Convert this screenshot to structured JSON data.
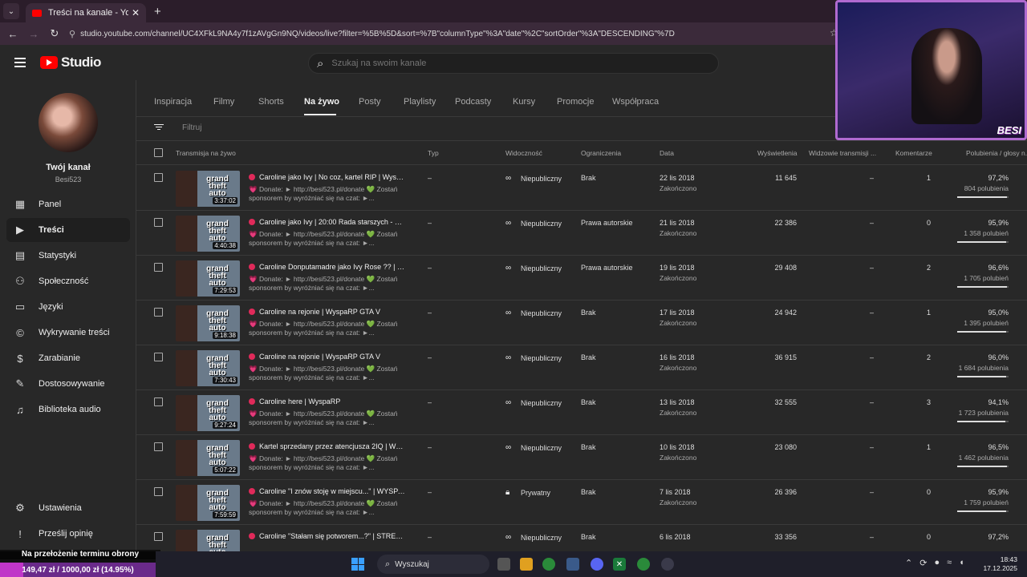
{
  "browser": {
    "tab_title": "Treści na kanale - YouTube Studio",
    "url": "studio.youtube.com/channel/UC4XFkL9NA4y7f1zAVgGn9NQ/videos/live?filter=%5B%5D&sort=%7B\"columnType\"%3A\"date\"%2C\"sortOrder\"%3A\"DESCENDING\"%7D"
  },
  "header": {
    "logo_text": "Studio",
    "search_placeholder": "Szukaj na swoim kanale"
  },
  "sidebar": {
    "channel_title": "Twój kanał",
    "channel_handle": "Besi523",
    "items": [
      {
        "label": "Panel",
        "icon": "dashboard-icon"
      },
      {
        "label": "Treści",
        "icon": "content-icon"
      },
      {
        "label": "Statystyki",
        "icon": "analytics-icon"
      },
      {
        "label": "Społeczność",
        "icon": "community-icon"
      },
      {
        "label": "Języki",
        "icon": "subtitles-icon"
      },
      {
        "label": "Wykrywanie treści",
        "icon": "copyright-icon"
      },
      {
        "label": "Zarabianie",
        "icon": "monetization-icon"
      },
      {
        "label": "Dostosowywanie",
        "icon": "customization-icon"
      },
      {
        "label": "Biblioteka audio",
        "icon": "audio-library-icon"
      }
    ],
    "settings_label": "Ustawienia",
    "feedback_label": "Prześlij opinię"
  },
  "content_tabs": [
    "Inspiracja",
    "Filmy",
    "Shorts",
    "Na żywo",
    "Posty",
    "Playlisty",
    "Podcasty",
    "Kursy",
    "Promocje",
    "Współpraca"
  ],
  "active_tab": "Na żywo",
  "filter_placeholder": "Filtruj",
  "columns": {
    "title": "Transmisja na żywo",
    "type": "Typ",
    "visibility": "Widoczność",
    "restrictions": "Ograniczenia",
    "date": "Data",
    "views": "Wyświetlenia",
    "live_viewers": "Widzowie transmisji ...",
    "comments": "Komentarze",
    "likes": "Polubienia / głosy n..."
  },
  "rows": [
    {
      "duration": "3:37:02",
      "title": "Caroline jako Ivy | No coz, kartel RIP | WyspaR...",
      "desc": "💗 Donate: ► http://besi523.pl/donate 💚 Zostań sponsorem by wyróżniać się na czat: ►...",
      "type": "–",
      "visibility": "Niepubliczny",
      "visibility_icon": "link-icon",
      "restrictions": "Brak",
      "date": "22 lis 2018",
      "status": "Zakończono",
      "views": "11 645",
      "live": "–",
      "comments": "1",
      "pct": "97,2%",
      "likes": "804 polubienia",
      "ratio": 0.972
    },
    {
      "duration": "4:40:38",
      "title": "Caroline jako Ivy | 20:00 Rada starszych - koni...",
      "desc": "💗 Donate: ► http://besi523.pl/donate 💚 Zostań sponsorem by wyróżniać się na czat: ►...",
      "type": "–",
      "visibility": "Niepubliczny",
      "visibility_icon": "link-icon",
      "restrictions": "Prawa autorskie",
      "date": "21 lis 2018",
      "status": "Zakończono",
      "views": "22 386",
      "live": "–",
      "comments": "0",
      "pct": "95,9%",
      "likes": "1 358 polubień",
      "ratio": 0.959
    },
    {
      "duration": "7:29:53",
      "title": "Caroline Donputamadre jako Ivy Rose ?? | Wy...",
      "desc": "💗 Donate: ► http://besi523.pl/donate 💚 Zostań sponsorem by wyróżniać się na czat: ►...",
      "type": "–",
      "visibility": "Niepubliczny",
      "visibility_icon": "link-icon",
      "restrictions": "Prawa autorskie",
      "date": "19 lis 2018",
      "status": "Zakończono",
      "views": "29 408",
      "live": "–",
      "comments": "2",
      "pct": "96,6%",
      "likes": "1 705 polubień",
      "ratio": 0.966
    },
    {
      "duration": "9:18:38",
      "title": "Caroline na rejonie | WyspaRP GTA V",
      "desc": "💗 Donate: ► http://besi523.pl/donate 💚 Zostań sponsorem by wyróżniać się na czat: ►...",
      "type": "–",
      "visibility": "Niepubliczny",
      "visibility_icon": "link-icon",
      "restrictions": "Brak",
      "date": "17 lis 2018",
      "status": "Zakończono",
      "views": "24 942",
      "live": "–",
      "comments": "1",
      "pct": "95,0%",
      "likes": "1 395 polubień",
      "ratio": 0.95
    },
    {
      "duration": "7:30:43",
      "title": "Caroline na rejonie | WyspaRP GTA V",
      "desc": "💗 Donate: ► http://besi523.pl/donate 💚 Zostań sponsorem by wyróżniać się na czat: ►...",
      "type": "–",
      "visibility": "Niepubliczny",
      "visibility_icon": "link-icon",
      "restrictions": "Brak",
      "date": "16 lis 2018",
      "status": "Zakończono",
      "views": "36 915",
      "live": "–",
      "comments": "2",
      "pct": "96,0%",
      "likes": "1 684 polubienia",
      "ratio": 0.96
    },
    {
      "duration": "9:27:24",
      "title": "Caroline here | WyspaRP",
      "desc": "💗 Donate: ► http://besi523.pl/donate 💚 Zostań sponsorem by wyróżniać się na czat: ►...",
      "type": "–",
      "visibility": "Niepubliczny",
      "visibility_icon": "link-icon",
      "restrictions": "Brak",
      "date": "13 lis 2018",
      "status": "Zakończono",
      "views": "32 555",
      "live": "–",
      "comments": "3",
      "pct": "94,1%",
      "likes": "1 723 polubienia",
      "ratio": 0.941
    },
    {
      "duration": "5:07:22",
      "title": "Kartel sprzedany przez atencjusza 2IQ | Wysp...",
      "desc": "💗 Donate: ► http://besi523.pl/donate 💚 Zostań sponsorem by wyróżniać się na czat: ►...",
      "type": "–",
      "visibility": "Niepubliczny",
      "visibility_icon": "link-icon",
      "restrictions": "Brak",
      "date": "10 lis 2018",
      "status": "Zakończono",
      "views": "23 080",
      "live": "–",
      "comments": "1",
      "pct": "96,5%",
      "likes": "1 462 polubienia",
      "ratio": 0.965
    },
    {
      "duration": "7:59:59",
      "title": "Caroline \"I znów stoję w miejscu...\" | WYSPAR...",
      "desc": "💗 Donate: ► http://besi523.pl/donate 💚 Zostań sponsorem by wyróżniać się na czat: ►...",
      "type": "–",
      "visibility": "Prywatny",
      "visibility_icon": "lock-icon",
      "restrictions": "Brak",
      "date": "7 lis 2018",
      "status": "Zakończono",
      "views": "26 396",
      "live": "–",
      "comments": "0",
      "pct": "95,9%",
      "likes": "1 759 polubień",
      "ratio": 0.959
    },
    {
      "duration": "",
      "title": "Caroline \"Stałam się potworem...?\" | STREFAR...",
      "desc": "",
      "type": "–",
      "visibility": "Niepubliczny",
      "visibility_icon": "link-icon",
      "restrictions": "Brak",
      "date": "6 lis 2018",
      "status": "",
      "views": "33 356",
      "live": "–",
      "comments": "0",
      "pct": "97,2%",
      "likes": "",
      "ratio": 0.972
    }
  ],
  "overlay": {
    "cam_tag": "BESI",
    "promo_text": "Na przełożenie terminu obrony",
    "goal_text": "149,47 zł / 1000,00 zł (14.95%)",
    "goal_ratio": 0.1495
  },
  "taskbar": {
    "search_label": "Wyszukaj",
    "time": "18:43",
    "date": "17.12.2025"
  }
}
